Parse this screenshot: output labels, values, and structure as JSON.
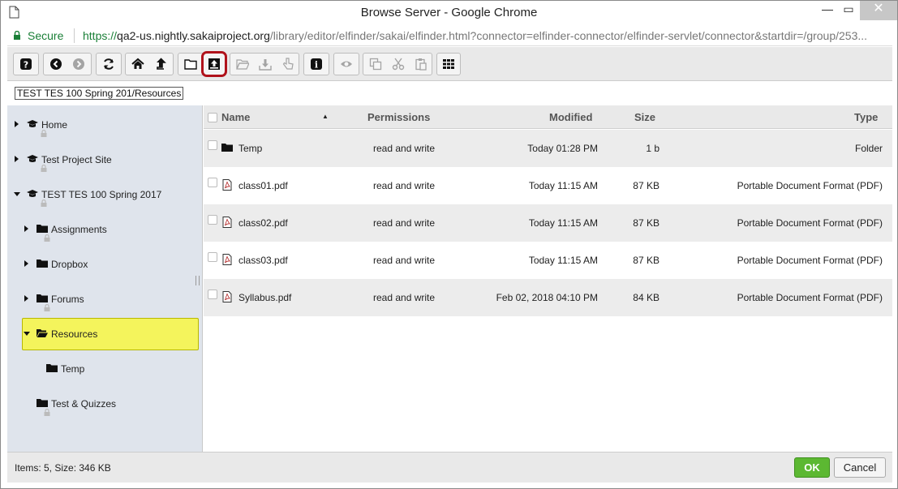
{
  "window": {
    "title": "Browse Server - Google Chrome",
    "minimize_symbol": "—",
    "maximize_symbol": "▭",
    "close_symbol": "✕"
  },
  "address_bar": {
    "secure_label": "Secure",
    "url_protocol": "https://",
    "url_host": "qa2-us.nightly.sakaiproject.org",
    "url_rest": "/library/editor/elfinder/sakai/elfinder.html?connector=elfinder-connector/elfinder-servlet/connector&startdir=/group/253..."
  },
  "toolbar": {
    "buttons": [
      {
        "name": "help-icon",
        "enabled": true
      },
      {
        "name": "back-icon",
        "enabled": true
      },
      {
        "name": "forward-icon",
        "enabled": false
      },
      {
        "name": "reload-icon",
        "enabled": true
      },
      {
        "name": "home-icon",
        "enabled": true
      },
      {
        "name": "up-icon",
        "enabled": true
      },
      {
        "name": "new-folder-icon",
        "enabled": true
      },
      {
        "name": "upload-icon",
        "enabled": true,
        "highlighted": true
      },
      {
        "name": "open-icon",
        "enabled": false
      },
      {
        "name": "download-icon",
        "enabled": false
      },
      {
        "name": "get-file-icon",
        "enabled": false
      },
      {
        "name": "info-icon",
        "enabled": true
      },
      {
        "name": "preview-icon",
        "enabled": false
      },
      {
        "name": "copy-icon",
        "enabled": false
      },
      {
        "name": "cut-icon",
        "enabled": false
      },
      {
        "name": "paste-icon",
        "enabled": false
      },
      {
        "name": "view-grid-icon",
        "enabled": true
      }
    ]
  },
  "path": "TEST TES 100 Spring 201/Resources",
  "tree": [
    {
      "label": "Home",
      "icon": "graduation-cap-icon",
      "expanded": false
    },
    {
      "label": "Test Project Site",
      "icon": "graduation-cap-icon",
      "expanded": false
    },
    {
      "label": "TEST TES 100 Spring 2017",
      "icon": "graduation-cap-icon",
      "expanded": true
    },
    {
      "label": "Assignments",
      "icon": "folder-icon",
      "expanded": false
    },
    {
      "label": "Dropbox",
      "icon": "folder-icon",
      "expanded": false
    },
    {
      "label": "Forums",
      "icon": "folder-icon",
      "expanded": false
    },
    {
      "label": "Resources",
      "icon": "folder-open-icon",
      "expanded": true,
      "selected": true
    },
    {
      "label": "Temp",
      "icon": "folder-icon",
      "expanded": false
    },
    {
      "label": "Test & Quizzes",
      "icon": "folder-icon",
      "expanded": false
    }
  ],
  "file_list": {
    "columns": {
      "name": "Name",
      "permissions": "Permissions",
      "modified": "Modified",
      "size": "Size",
      "type": "Type"
    },
    "sort_indicator": "▲",
    "rows": [
      {
        "name": "Temp",
        "icon": "folder-icon",
        "permissions": "read and write",
        "modified": "Today 01:28 PM",
        "size": "1 b",
        "type": "Folder"
      },
      {
        "name": "class01.pdf",
        "icon": "pdf-file-icon",
        "permissions": "read and write",
        "modified": "Today 11:15 AM",
        "size": "87 KB",
        "type": "Portable Document Format (PDF)"
      },
      {
        "name": "class02.pdf",
        "icon": "pdf-file-icon",
        "permissions": "read and write",
        "modified": "Today 11:15 AM",
        "size": "87 KB",
        "type": "Portable Document Format (PDF)"
      },
      {
        "name": "class03.pdf",
        "icon": "pdf-file-icon",
        "permissions": "read and write",
        "modified": "Today 11:15 AM",
        "size": "87 KB",
        "type": "Portable Document Format (PDF)"
      },
      {
        "name": "Syllabus.pdf",
        "icon": "pdf-file-icon",
        "permissions": "read and write",
        "modified": "Feb 02, 2018 04:10 PM",
        "size": "84 KB",
        "type": "Portable Document Format (PDF)"
      }
    ]
  },
  "status": {
    "info": "Items: 5, Size: 346 KB",
    "ok_label": "OK",
    "cancel_label": "Cancel"
  },
  "colors": {
    "secure_green": "#1a7f37",
    "ok_green": "#5cb832",
    "selected_yellow": "#f4f45c",
    "highlight_red": "#b0121b",
    "sidebar_bg": "#dfe4ec"
  }
}
